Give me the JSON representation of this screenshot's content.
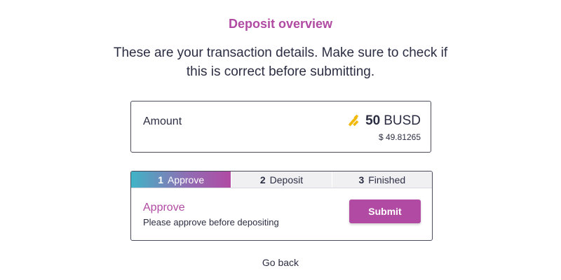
{
  "header": {
    "title": "Deposit overview",
    "subtitle": "These are your transaction details. Make sure to check if this is correct before submitting."
  },
  "amount_card": {
    "label": "Amount",
    "value": "50",
    "currency": "BUSD",
    "icon": "busd-token-icon",
    "usd_value": "$ 49.81265"
  },
  "steps": [
    {
      "number": "1",
      "label": "Approve",
      "active": true
    },
    {
      "number": "2",
      "label": "Deposit",
      "active": false
    },
    {
      "number": "3",
      "label": "Finished",
      "active": false
    }
  ],
  "approve_panel": {
    "heading": "Approve",
    "description": "Please approve before depositing",
    "submit_label": "Submit"
  },
  "footer": {
    "go_back_label": "Go back"
  },
  "colors": {
    "accent": "#b14aa3",
    "gradient_start": "#3fb4c7",
    "token_gold": "#f0b90b",
    "text": "#2b2d42",
    "border": "#4a4c5c"
  }
}
